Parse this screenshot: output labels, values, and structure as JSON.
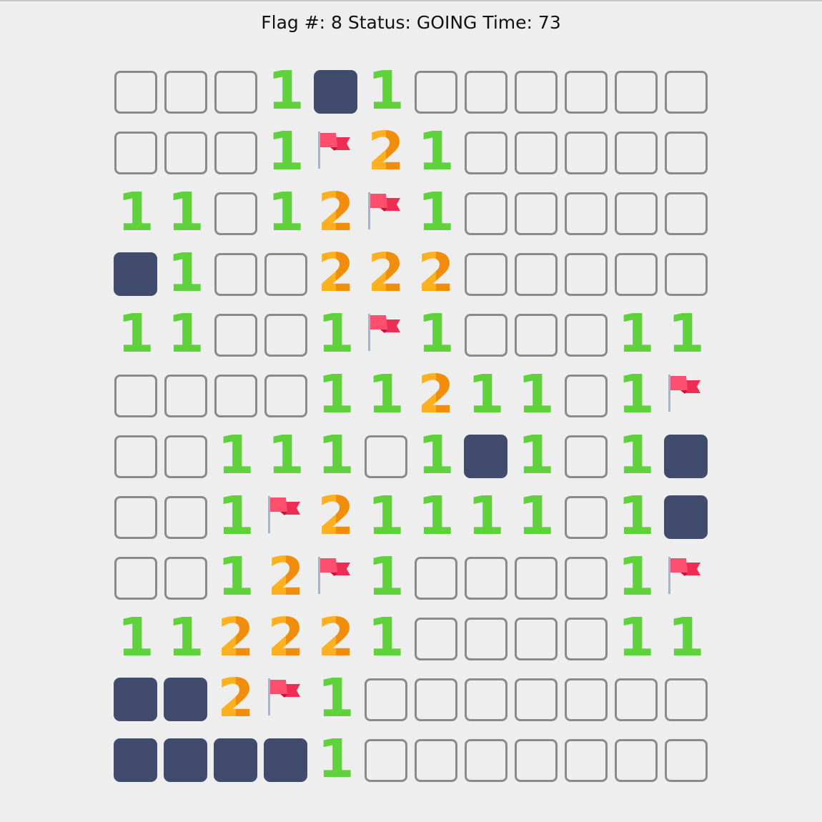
{
  "status_bar": {
    "text": "Flag #: 8 Status: GOING Time: 73",
    "flag_count": 8,
    "status": "GOING",
    "time": 73
  },
  "colors": {
    "background": "#eeeeee",
    "unrevealed_border": "#8a8a8a",
    "mine_tile": "#414b6d",
    "number_1": "#5fd13a",
    "number_2": "#ffa11a",
    "flag": "#ff4f6e",
    "flag_pole": "#a7b3c7"
  },
  "legend": {
    "E": "unrevealed-tile",
    "M": "mine-tile",
    "F": "flag-icon",
    "1": "number-1",
    "2": "number-2"
  },
  "board": {
    "rows": 12,
    "cols": 12,
    "grid": [
      [
        "E",
        "E",
        "E",
        "1",
        "M",
        "1",
        "E",
        "E",
        "E",
        "E",
        "E",
        "E"
      ],
      [
        "E",
        "E",
        "E",
        "1",
        "F",
        "2",
        "1",
        "E",
        "E",
        "E",
        "E",
        "E"
      ],
      [
        "1",
        "1",
        "E",
        "1",
        "2",
        "F",
        "1",
        "E",
        "E",
        "E",
        "E",
        "E"
      ],
      [
        "M",
        "1",
        "E",
        "E",
        "2",
        "2",
        "2",
        "E",
        "E",
        "E",
        "E",
        "E"
      ],
      [
        "1",
        "1",
        "E",
        "E",
        "1",
        "F",
        "1",
        "E",
        "E",
        "E",
        "1",
        "1"
      ],
      [
        "E",
        "E",
        "E",
        "E",
        "1",
        "1",
        "2",
        "1",
        "1",
        "E",
        "1",
        "F"
      ],
      [
        "E",
        "E",
        "1",
        "1",
        "1",
        "E",
        "1",
        "M",
        "1",
        "E",
        "1",
        "M"
      ],
      [
        "E",
        "E",
        "1",
        "F",
        "2",
        "1",
        "1",
        "1",
        "1",
        "E",
        "1",
        "M"
      ],
      [
        "E",
        "E",
        "1",
        "2",
        "F",
        "1",
        "E",
        "E",
        "E",
        "E",
        "1",
        "F"
      ],
      [
        "1",
        "1",
        "2",
        "2",
        "2",
        "1",
        "E",
        "E",
        "E",
        "E",
        "1",
        "1"
      ],
      [
        "M",
        "M",
        "2",
        "F",
        "1",
        "E",
        "E",
        "E",
        "E",
        "E",
        "E",
        "E"
      ],
      [
        "M",
        "M",
        "M",
        "M",
        "1",
        "E",
        "E",
        "E",
        "E",
        "E",
        "E",
        "E"
      ]
    ]
  }
}
